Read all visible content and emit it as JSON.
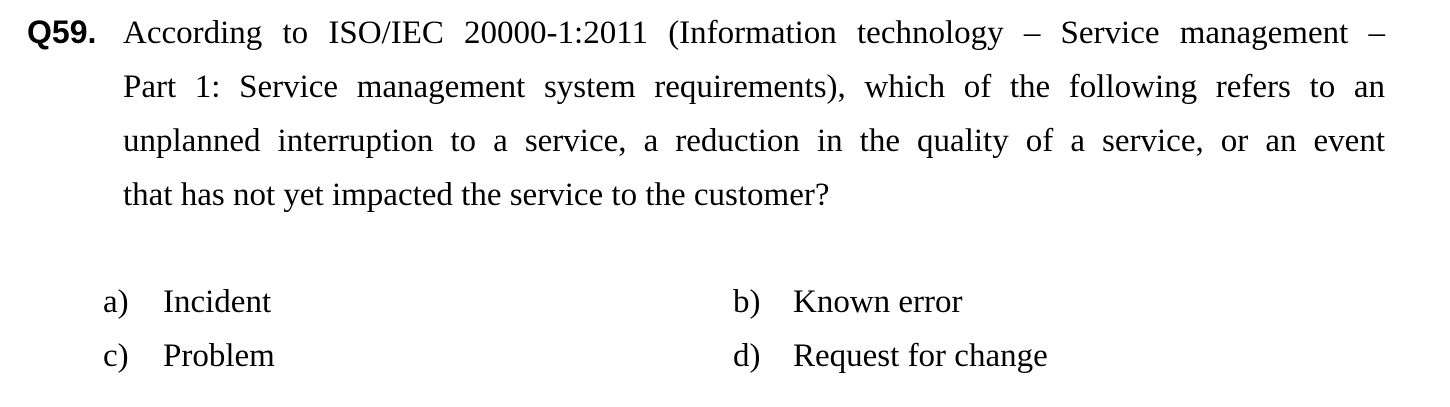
{
  "question": {
    "number": "Q59.",
    "lines": [
      "According to ISO/IEC 20000-1:2011 (Information technology – Service management –",
      "Part 1: Service management system requirements), which of the following refers to an",
      "unplanned interruption to a service, a reduction in the quality of a service, or an event",
      "that has not yet impacted the service to the customer?"
    ]
  },
  "options": [
    {
      "letter": "a)",
      "text": "Incident"
    },
    {
      "letter": "b)",
      "text": "Known error"
    },
    {
      "letter": "c)",
      "text": "Problem"
    },
    {
      "letter": "d)",
      "text": "Request for change"
    }
  ]
}
